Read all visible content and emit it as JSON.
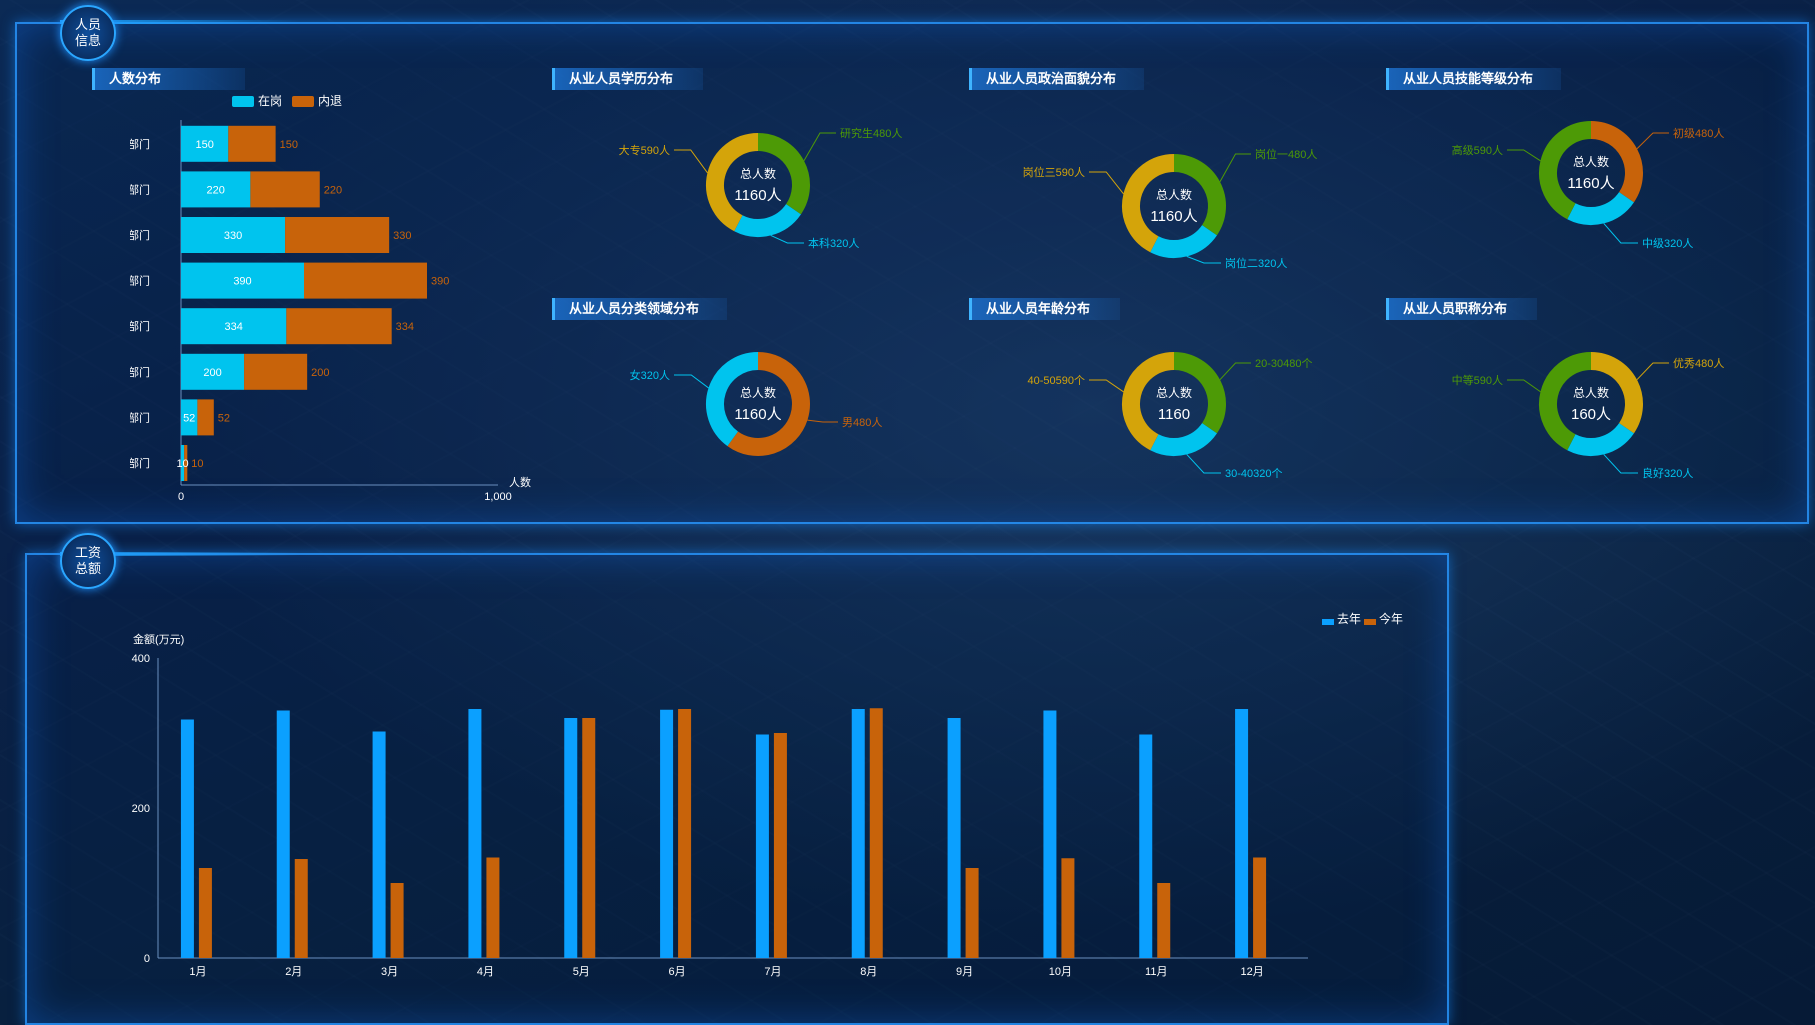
{
  "colors": {
    "cyan": "#00c4ee",
    "orange": "#c8630a",
    "green": "#4d9a06",
    "gold": "#d4a40a",
    "blue": "#0ba0ff"
  },
  "top_badge": "人员信息",
  "bottom_badge": "工资总额",
  "bar_section": {
    "title": "人数分布",
    "legend": [
      "在岗",
      "内退"
    ],
    "x_unit": "人数",
    "x_ticks": [
      "0",
      "1,000"
    ]
  },
  "donuts": [
    {
      "title": "从业人员学历分布",
      "center_top": "总人数",
      "center_value": "1160人",
      "segments": [
        {
          "label": "研究生480人",
          "value": 480,
          "color": "green"
        },
        {
          "label": "本科320人",
          "value": 320,
          "color": "cyan"
        },
        {
          "label": "大专590人",
          "value": 590,
          "color": "gold"
        }
      ]
    },
    {
      "title": "从业人员政治面貌分布",
      "center_top": "总人数",
      "center_value": "1160人",
      "segments": [
        {
          "label": "岗位一480人",
          "value": 480,
          "color": "green"
        },
        {
          "label": "岗位二320人",
          "value": 320,
          "color": "cyan"
        },
        {
          "label": "岗位三590人",
          "value": 590,
          "color": "gold"
        }
      ]
    },
    {
      "title": "从业人员技能等级分布",
      "center_top": "总人数",
      "center_value": "1160人",
      "segments": [
        {
          "label": "初级480人",
          "value": 480,
          "color": "orange"
        },
        {
          "label": "中级320人",
          "value": 320,
          "color": "cyan"
        },
        {
          "label": "高级590人",
          "value": 590,
          "color": "green"
        }
      ]
    },
    {
      "title": "从业人员分类领域分布",
      "center_top": "总人数",
      "center_value": "1160人",
      "segments": [
        {
          "label": "男480人",
          "value": 480,
          "color": "orange"
        },
        {
          "label": "女320人",
          "value": 320,
          "color": "cyan"
        }
      ]
    },
    {
      "title": "从业人员年龄分布",
      "center_top": "总人数",
      "center_value": "1160",
      "segments": [
        {
          "label": "20-30480个",
          "value": 480,
          "color": "green"
        },
        {
          "label": "30-40320个",
          "value": 320,
          "color": "cyan"
        },
        {
          "label": "40-50590个",
          "value": 590,
          "color": "gold"
        }
      ]
    },
    {
      "title": "从业人员职称分布",
      "center_top": "总人数",
      "center_value": "160人",
      "segments": [
        {
          "label": "优秀480人",
          "value": 480,
          "color": "gold"
        },
        {
          "label": "良好320人",
          "value": 320,
          "color": "cyan"
        },
        {
          "label": "中等590人",
          "value": 590,
          "color": "green"
        }
      ]
    }
  ],
  "chart_data": [
    {
      "type": "bar",
      "title": "人数分布",
      "orientation": "horizontal-stacked",
      "categories": [
        "部门",
        "部门",
        "部门",
        "部门",
        "部门",
        "部门",
        "部门",
        "部门"
      ],
      "series": [
        {
          "name": "在岗",
          "values": [
            150,
            220,
            330,
            390,
            334,
            200,
            52,
            10
          ]
        },
        {
          "name": "内退",
          "values": [
            150,
            220,
            330,
            390,
            334,
            200,
            52,
            10
          ]
        }
      ],
      "xlabel": "人数",
      "xlim": [
        0,
        1000
      ]
    },
    {
      "type": "bar",
      "title": "",
      "ylabel": "金额(万元)",
      "categories": [
        "1月",
        "2月",
        "3月",
        "4月",
        "5月",
        "6月",
        "7月",
        "8月",
        "9月",
        "10月",
        "11月",
        "12月"
      ],
      "series": [
        {
          "name": "去年",
          "values": [
            318,
            330,
            302,
            332,
            320,
            331,
            298,
            332,
            320,
            330,
            298,
            332
          ]
        },
        {
          "name": "今年",
          "values": [
            120,
            132,
            100,
            134,
            320,
            332,
            300,
            333,
            120,
            133,
            100,
            134
          ]
        }
      ],
      "ylim": [
        0,
        400
      ],
      "y_ticks": [
        "0",
        "200",
        "400"
      ],
      "legend": [
        "去年",
        "今年"
      ]
    }
  ]
}
